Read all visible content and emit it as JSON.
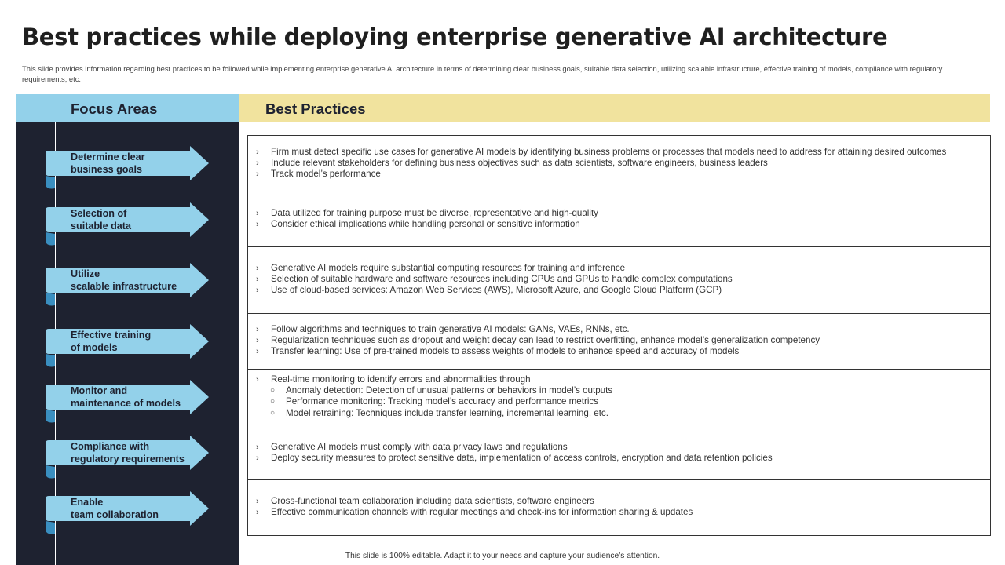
{
  "header": {
    "title": "Best practices while deploying enterprise generative AI architecture",
    "subtitle": "This slide provides information regarding best practices to be followed while implementing enterprise generative AI architecture in terms of determining clear business goals, suitable data selection, utilizing scalable infrastructure, effective training of models, compliance with regulatory requirements, etc."
  },
  "columns": {
    "focus": "Focus Areas",
    "practices": "Best Practices"
  },
  "colors": {
    "dark_panel": "#1e2230",
    "light_blue": "#93d1ea",
    "yellow": "#f1e39e",
    "arrow_shadow": "#3a8fc0"
  },
  "rows": [
    {
      "focus": [
        "Determine clear",
        "business goals"
      ],
      "bullets": [
        {
          "text": "Firm must detect specific use cases for generative AI models by identifying business problems or processes that models need to address for attaining desired outcomes",
          "level": 1
        },
        {
          "text": "Include relevant stakeholders for defining business objectives such as data scientists, software engineers, business leaders",
          "level": 1
        },
        {
          "text": "Track model’s performance",
          "level": 1
        }
      ]
    },
    {
      "focus": [
        "Selection of",
        "suitable data"
      ],
      "bullets": [
        {
          "text": "Data utilized for training purpose must be diverse, representative and high-quality",
          "level": 1
        },
        {
          "text": "Consider ethical implications while handling personal or sensitive information",
          "level": 1
        }
      ]
    },
    {
      "focus": [
        "Utilize",
        "scalable infrastructure"
      ],
      "bullets": [
        {
          "text": "Generative AI models require substantial computing resources for training and inference",
          "level": 1
        },
        {
          "text": "Selection of suitable hardware and software resources including CPUs and GPUs to handle complex computations",
          "level": 1
        },
        {
          "text": "Use of cloud-based services: Amazon Web Services (AWS), Microsoft Azure, and Google Cloud Platform (GCP)",
          "level": 1
        }
      ]
    },
    {
      "focus": [
        "Effective training",
        "of models"
      ],
      "bullets": [
        {
          "text": "Follow algorithms and techniques to train generative AI models: GANs, VAEs, RNNs, etc.",
          "level": 1
        },
        {
          "text": "Regularization techniques such as dropout and weight decay can lead to restrict overfitting, enhance model’s generalization competency",
          "level": 1
        },
        {
          "text": "Transfer learning: Use of pre-trained models to assess weights of models to enhance speed and accuracy of models",
          "level": 1
        }
      ]
    },
    {
      "focus": [
        "Monitor and",
        "maintenance of models"
      ],
      "bullets": [
        {
          "text": "Real-time monitoring to identify errors and abnormalities through",
          "level": 1
        },
        {
          "text": "Anomaly detection: Detection of unusual patterns or behaviors in model’s outputs",
          "level": 2
        },
        {
          "text": "Performance monitoring: Tracking model’s accuracy and performance metrics",
          "level": 2
        },
        {
          "text": "Model retraining: Techniques include transfer learning, incremental learning, etc.",
          "level": 2
        }
      ]
    },
    {
      "focus": [
        "Compliance with",
        "regulatory requirements"
      ],
      "bullets": [
        {
          "text": "Generative AI models must comply with data privacy laws and regulations",
          "level": 1
        },
        {
          "text": "Deploy security measures to protect sensitive data, implementation of access controls, encryption and data retention policies",
          "level": 1
        }
      ]
    },
    {
      "focus": [
        "Enable",
        "team collaboration"
      ],
      "bullets": [
        {
          "text": "Cross-functional team collaboration including data scientists, software engineers",
          "level": 1
        },
        {
          "text": "Effective communication channels with regular meetings and check-ins for information sharing & updates",
          "level": 1
        }
      ]
    }
  ],
  "footer": "This slide is 100% editable. Adapt it to your needs and capture your audience’s attention."
}
